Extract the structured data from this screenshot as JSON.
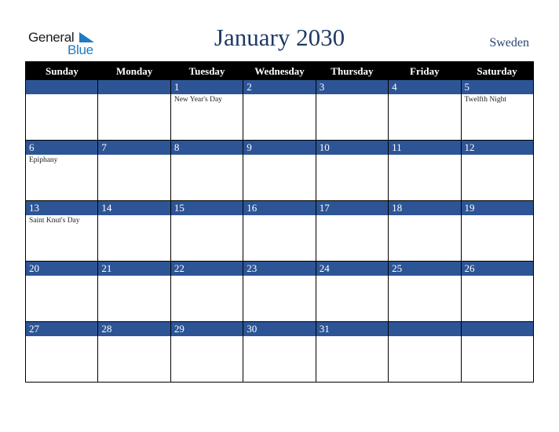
{
  "logo": {
    "word1": "General",
    "word2": "Blue",
    "accent_color": "#1f7ac2"
  },
  "header": {
    "title": "January 2030",
    "country": "Sweden"
  },
  "colors": {
    "header_bg": "#000000",
    "band_bg": "#2d5596",
    "title": "#1f3a66"
  },
  "weekdays": [
    "Sunday",
    "Monday",
    "Tuesday",
    "Wednesday",
    "Thursday",
    "Friday",
    "Saturday"
  ],
  "weeks": [
    {
      "days": [
        "",
        "",
        "1",
        "2",
        "3",
        "4",
        "5"
      ],
      "events": [
        "",
        "",
        "New Year's Day",
        "",
        "",
        "",
        "Twelfth Night"
      ]
    },
    {
      "days": [
        "6",
        "7",
        "8",
        "9",
        "10",
        "11",
        "12"
      ],
      "events": [
        "Epiphany",
        "",
        "",
        "",
        "",
        "",
        ""
      ]
    },
    {
      "days": [
        "13",
        "14",
        "15",
        "16",
        "17",
        "18",
        "19"
      ],
      "events": [
        "Saint Knut's Day",
        "",
        "",
        "",
        "",
        "",
        ""
      ]
    },
    {
      "days": [
        "20",
        "21",
        "22",
        "23",
        "24",
        "25",
        "26"
      ],
      "events": [
        "",
        "",
        "",
        "",
        "",
        "",
        ""
      ]
    },
    {
      "days": [
        "27",
        "28",
        "29",
        "30",
        "31",
        "",
        ""
      ],
      "events": [
        "",
        "",
        "",
        "",
        "",
        "",
        ""
      ]
    }
  ]
}
